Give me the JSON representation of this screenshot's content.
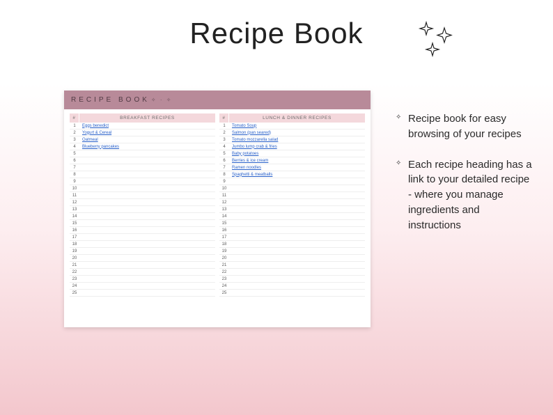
{
  "page_title": "Recipe Book",
  "side_bullets": [
    "Recipe book for easy browsing of your recipes",
    "Each recipe heading has a link to your detailed recipe - where you manage ingredients and instructions"
  ],
  "sheet": {
    "header": "RECIPE BOOK",
    "row_count": 25,
    "num_header": "#",
    "columns": [
      {
        "label": "BREAKFAST RECIPES",
        "items": [
          "Eggs benedict",
          "Yogurt & Cereal",
          "Oatmeal",
          "Blueberry pancakes"
        ]
      },
      {
        "label": "LUNCH & DINNER RECIPES",
        "items": [
          "Tomato Soup",
          "Salmon (pan seared)",
          "Tomato mozzarella salad",
          "Jumbo lump crab & fries",
          "Baby potatoes",
          "Berries & ice cream",
          "Ramen noodles",
          "Spaghetti & meatballs"
        ]
      }
    ]
  }
}
